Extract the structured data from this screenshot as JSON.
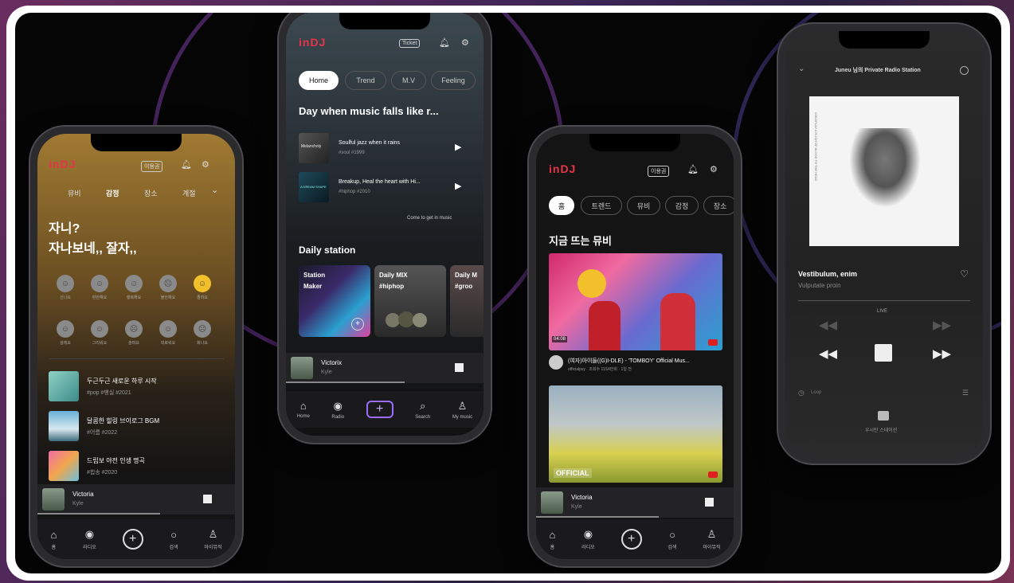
{
  "phone1": {
    "tabs": [
      "뮤비",
      "감정",
      "장소",
      "계절"
    ],
    "ticket": "이용권",
    "heading_line1": "자니?",
    "heading_line2": "자나보네,, 잘자,,",
    "emotions_row1": [
      "신나요",
      "편안해요",
      "행복해요",
      "불안해요",
      "졸려요"
    ],
    "emotions_row2": [
      "설레요",
      "그리워요",
      "슬퍼요",
      "외로워요",
      "화나요"
    ],
    "tracks": [
      {
        "title": "두근두근 새로운 하루 시작",
        "tags": "#pop #뱅실 #2021"
      },
      {
        "title": "달콤한 힐링 브이로그 BGM",
        "tags": "#어름 #2022"
      },
      {
        "title": "드립보 야전 인생 명곡",
        "tags": "#힙송 #2020"
      }
    ],
    "mini_title": "Victoria",
    "mini_artist": "Kyle",
    "nav": [
      "홈",
      "라디오",
      "",
      "검색",
      "마이뮤직"
    ]
  },
  "phone2": {
    "logo": "inDJ",
    "ticket": "Ticket",
    "tabs": [
      "Home",
      "Trend",
      "M.V",
      "Feeling"
    ],
    "headline": "Day when music falls like r...",
    "tracks": [
      {
        "title": "Soulful jazz when it rains",
        "tags": "#soul #1999",
        "thumb_text": "Melancholy"
      },
      {
        "title": "Breakup, Heal the heart with Hi...",
        "tags": "#hiphop #2010",
        "thumb_text": "A DREAM SHAPE"
      }
    ],
    "more_link": "Come to get in music",
    "section": "Daily station",
    "stations": [
      {
        "line1": "Station",
        "line2": "Maker"
      },
      {
        "line1": "Daily MIX",
        "line2": "#hiphop"
      },
      {
        "line1": "Daily M",
        "line2": "#groo"
      }
    ],
    "mini_title": "Victorix",
    "mini_artist": "Kyle",
    "nav": [
      "Home",
      "Radio",
      "",
      "Search",
      "My music"
    ]
  },
  "phone3": {
    "logo": "inDJ",
    "ticket": "이용권",
    "tabs": [
      "홈",
      "트렌드",
      "뮤비",
      "감정",
      "장소"
    ],
    "section": "지금 뜨는 뮤비",
    "videos": [
      {
        "duration": "04:08",
        "title": "(여자)아이들((G)I-DLE) - 'TOMBOY' Official Mus...",
        "meta": "officialpsy · 조회수 11S4만회 · 1일 전"
      },
      {
        "overlay": "OFFICIAL"
      }
    ],
    "mini_title": "Victoria",
    "mini_artist": "Kyle",
    "nav": [
      "홈",
      "라디오",
      "",
      "검색",
      "마이뮤직"
    ]
  },
  "phone4": {
    "title": "Juneu 님의 Private Radio Station",
    "song": "Vestibulum, enim",
    "artist": "Vulputate proin",
    "live": "LIVE",
    "timer": "Loop",
    "station_label": "우시탄 스테이션",
    "album_spine": "COLDPLAY A RUSH OF BLOOD TO THE HEAD"
  },
  "colors": {
    "brand": "#e8344a",
    "accent_purple": "#9a6cff"
  }
}
